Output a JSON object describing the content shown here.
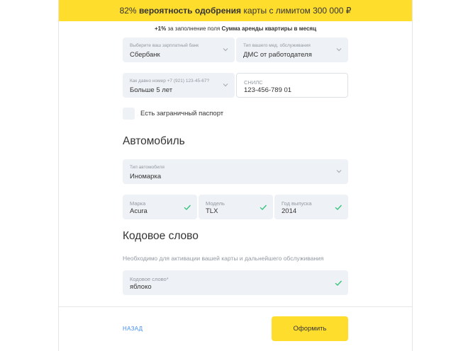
{
  "banner": {
    "percent": "82%",
    "bold": "вероятность одобрения",
    "rest": "карты с лимитом 300 000 ₽"
  },
  "hint": {
    "bonus": "+1%",
    "middle": "за заполнение поля",
    "field": "Сумма аренды квартиры в месяц"
  },
  "fields": {
    "bank": {
      "label": "Выберите ваш зарплатный банк",
      "value": "Сбербанк"
    },
    "med": {
      "label": "Тип вашего мед. обслуживания",
      "value": "ДМС от работодателя"
    },
    "phone_age": {
      "label": "Как давно номер +7 (921) 123-45-67?",
      "value": "Больше 5 лет"
    },
    "snils": {
      "label": "СНИЛС",
      "value": "123-456-789 01"
    }
  },
  "passport": {
    "label": "Есть заграничный паспорт",
    "checked": false
  },
  "car": {
    "heading": "Автомобиль",
    "type": {
      "label": "Тип автомобиля",
      "value": "Иномарка"
    },
    "brand": {
      "label": "Марка",
      "value": "Acura"
    },
    "model": {
      "label": "Модель",
      "value": "TLX"
    },
    "year": {
      "label": "Год выпуска",
      "value": "2014"
    }
  },
  "codeword": {
    "heading": "Кодовое слово",
    "note": "Необходимо для активации вашей карты и дальнейшего обслуживания",
    "label": "Кодовое слово*",
    "value": "яблоко"
  },
  "footer": {
    "back": "НАЗАД",
    "submit": "Оформить"
  },
  "colors": {
    "accent": "#ffdd2d",
    "field_bg": "#eef1f5",
    "check": "#2fc178",
    "link": "#428bf9"
  },
  "icons": {
    "dropdown": "chevron-down-icon",
    "valid": "checkmark-icon"
  }
}
